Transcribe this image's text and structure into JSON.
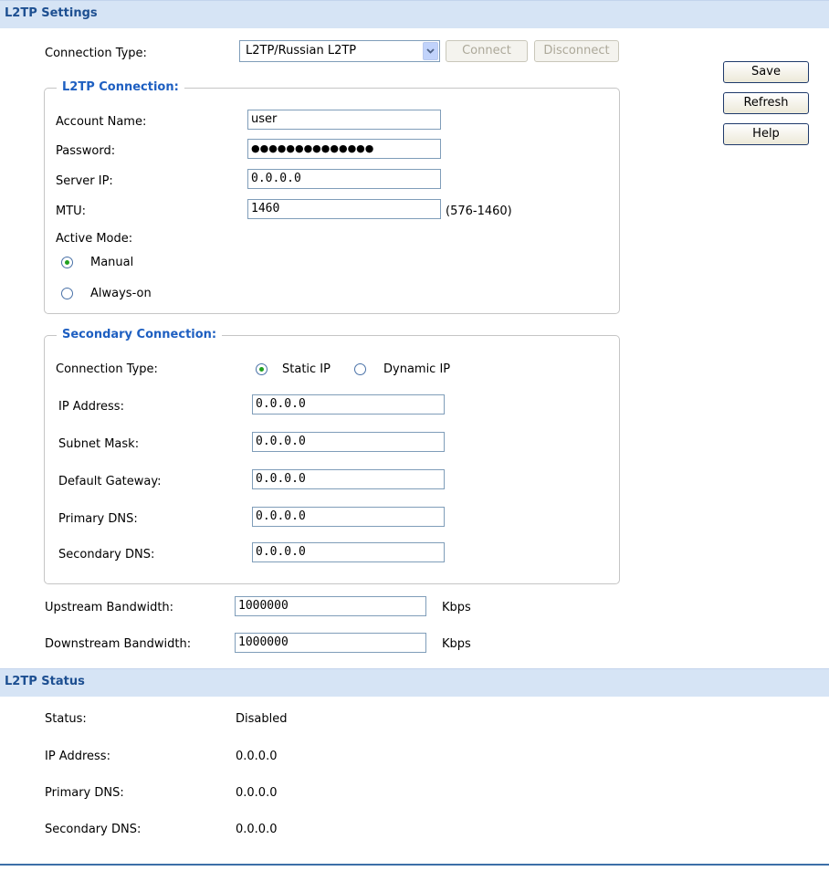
{
  "settings": {
    "title": "L2TP Settings",
    "connection_type_label": "Connection Type:",
    "connection_type_value": "L2TP/Russian L2TP",
    "connect_label": "Connect",
    "disconnect_label": "Disconnect"
  },
  "side_buttons": {
    "save": "Save",
    "refresh": "Refresh",
    "help": "Help"
  },
  "l2tp": {
    "legend": "L2TP Connection:",
    "account_label": "Account Name:",
    "account_value": "user",
    "password_label": "Password:",
    "password_value": "●●●●●●●●●●●●●●",
    "server_ip_label": "Server IP:",
    "server_ip_value": "0.0.0.0",
    "mtu_label": "MTU:",
    "mtu_value": "1460",
    "mtu_range": "(576-1460)",
    "active_mode_label": "Active Mode:",
    "mode_manual": "Manual",
    "mode_always_on": "Always-on"
  },
  "secondary": {
    "legend": "Secondary Connection:",
    "conn_type_label": "Connection Type:",
    "static_ip_label": "Static IP",
    "dynamic_ip_label": "Dynamic IP",
    "ip_label": "IP Address:",
    "ip_value": "0.0.0.0",
    "mask_label": "Subnet Mask:",
    "mask_value": "0.0.0.0",
    "gateway_label": "Default Gateway:",
    "gateway_value": "0.0.0.0",
    "pdns_label": "Primary DNS:",
    "pdns_value": "0.0.0.0",
    "sdns_label": "Secondary DNS:",
    "sdns_value": "0.0.0.0"
  },
  "bandwidth": {
    "up_label": "Upstream Bandwidth:",
    "up_value": "1000000",
    "down_label": "Downstream Bandwidth:",
    "down_value": "1000000",
    "unit": "Kbps"
  },
  "status": {
    "title": "L2TP Status",
    "status_label": "Status:",
    "status_value": "Disabled",
    "ip_label": "IP Address:",
    "ip_value": "0.0.0.0",
    "pdns_label": "Primary DNS:",
    "pdns_value": "0.0.0.0",
    "sdns_label": "Secondary DNS:",
    "sdns_value": "0.0.0.0"
  }
}
